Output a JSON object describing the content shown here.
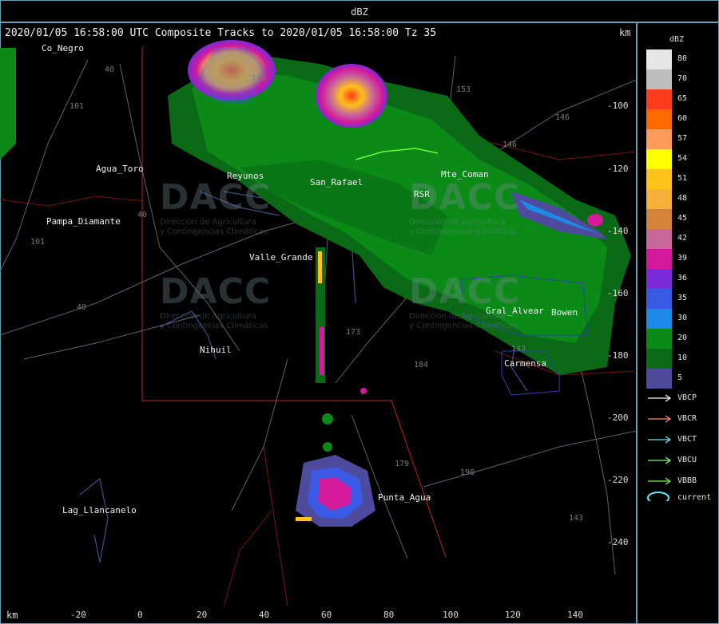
{
  "header": {
    "title": "dBZ"
  },
  "map": {
    "title": "2020/01/05 16:58:00 UTC Composite Tracks to 2020/01/05 16:58:00 Tz 35",
    "unit_top": "km",
    "unit_bottom": "km",
    "y_ticks": [
      "-100",
      "-120",
      "-140",
      "-160",
      "-180",
      "-200",
      "-220",
      "-240"
    ],
    "x_ticks": [
      "-20",
      "0",
      "20",
      "40",
      "60",
      "80",
      "100",
      "120",
      "140"
    ],
    "places": [
      "Co_Negro",
      "Agua_Toro",
      "Pampa_Diamante",
      "Reyunos",
      "San_Rafael",
      "RSR",
      "Mte_Coman",
      "Valle_Grande",
      "Gral_Alvear",
      "Bowen",
      "Nihuil",
      "Carmensa",
      "Punta_Agua",
      "Lag_Llancanelo"
    ],
    "roads": [
      "40",
      "101",
      "40",
      "101",
      "40",
      "143",
      "153",
      "146",
      "146",
      "173",
      "184",
      "179",
      "190",
      "143",
      "143"
    ],
    "watermark": {
      "logo": "DACC",
      "line1": "Dirección de Agricultura",
      "line2": "y Contingencias Climáticas"
    }
  },
  "legend": {
    "title": "dBZ",
    "levels": [
      {
        "label": "80",
        "color": "#e6e6e6"
      },
      {
        "label": "70",
        "color": "#bdbdbd"
      },
      {
        "label": "65",
        "color": "#ff3b1e"
      },
      {
        "label": "60",
        "color": "#ff6a00"
      },
      {
        "label": "57",
        "color": "#ff9b5c"
      },
      {
        "label": "54",
        "color": "#ffff00"
      },
      {
        "label": "51",
        "color": "#ffc21a"
      },
      {
        "label": "48",
        "color": "#f5b23a"
      },
      {
        "label": "45",
        "color": "#d3843a"
      },
      {
        "label": "42",
        "color": "#c8689a"
      },
      {
        "label": "39",
        "color": "#d21a9b"
      },
      {
        "label": "36",
        "color": "#7a2ad6"
      },
      {
        "label": "35",
        "color": "#3a5ae6"
      },
      {
        "label": "30",
        "color": "#1c8ae6"
      },
      {
        "label": "20",
        "color": "#0c8a18"
      },
      {
        "label": "10",
        "color": "#0a6a16"
      },
      {
        "label": "5",
        "color": "#4e4a9e"
      }
    ],
    "tracks": [
      {
        "label": "VBCP",
        "color": "#ffffff"
      },
      {
        "label": "VBCR",
        "color": "#ff8a6a"
      },
      {
        "label": "VBCT",
        "color": "#6ae6ff"
      },
      {
        "label": "VBCU",
        "color": "#7aff7a"
      },
      {
        "label": "VBBB",
        "color": "#66ff33"
      }
    ],
    "current": {
      "label": "current",
      "color": "#5ee6ff"
    }
  }
}
